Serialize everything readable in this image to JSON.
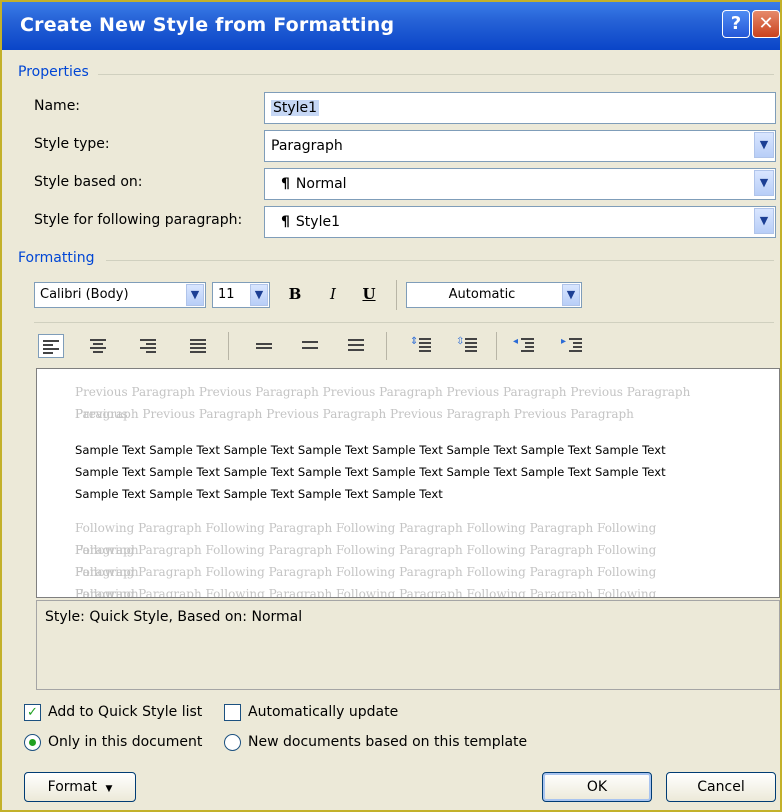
{
  "window": {
    "title": "Create New Style from Formatting",
    "help_label": "?",
    "close_label": "✕"
  },
  "properties": {
    "section_label": "Properties",
    "name_label": "Name:",
    "name_value": "Style1",
    "style_type_label": "Style type:",
    "style_type_value": "Paragraph",
    "based_on_label": "Style based on:",
    "based_on_value": "Normal",
    "following_label": "Style for following paragraph:",
    "following_value": "Style1"
  },
  "formatting": {
    "section_label": "Formatting",
    "font": "Calibri (Body)",
    "size": "11",
    "bold": "B",
    "italic": "I",
    "underline": "U",
    "color": "Automatic"
  },
  "preview": {
    "previous_line1": "Previous Paragraph Previous Paragraph Previous Paragraph Previous Paragraph Previous Paragraph Previous",
    "previous_line2": "Paragraph Previous Paragraph Previous Paragraph Previous Paragraph Previous Paragraph",
    "sample_line1": "Sample Text Sample Text Sample Text Sample Text Sample Text Sample Text Sample Text Sample Text",
    "sample_line2": "Sample Text Sample Text Sample Text Sample Text Sample Text Sample Text Sample Text Sample Text",
    "sample_line3": "Sample Text Sample Text Sample Text Sample Text Sample Text",
    "following_line1": "Following Paragraph Following Paragraph Following Paragraph Following Paragraph Following Paragraph",
    "following_line2": "Following Paragraph Following Paragraph Following Paragraph Following Paragraph Following Paragraph",
    "following_line3": "Following Paragraph Following Paragraph Following Paragraph Following Paragraph Following Paragraph",
    "following_line4": "Following Paragraph Following Paragraph Following Paragraph Following Paragraph Following Paragraph"
  },
  "description": "Style: Quick Style, Based on: Normal",
  "options": {
    "add_quick_style": "Add to Quick Style list",
    "add_quick_style_checked": true,
    "auto_update": "Automatically update",
    "auto_update_checked": false,
    "only_this_doc": "Only in this document",
    "new_docs": "New documents based on this template",
    "selected_scope": "Only in this document"
  },
  "buttons": {
    "format": "Format",
    "ok": "OK",
    "cancel": "Cancel"
  },
  "colors": {
    "title_bar": "#0a45c8",
    "accent": "#0046d5",
    "dialog_bg": "#ece9d8"
  },
  "icons": [
    "help-icon",
    "close-icon",
    "dropdown-arrow-icon",
    "pilcrow-icon",
    "align-left-icon",
    "align-center-icon",
    "align-right-icon",
    "justify-icon",
    "single-spacing-icon",
    "one-half-spacing-icon",
    "double-spacing-icon",
    "increase-paragraph-spacing-icon",
    "decrease-paragraph-spacing-icon",
    "decrease-indent-icon",
    "increase-indent-icon"
  ]
}
